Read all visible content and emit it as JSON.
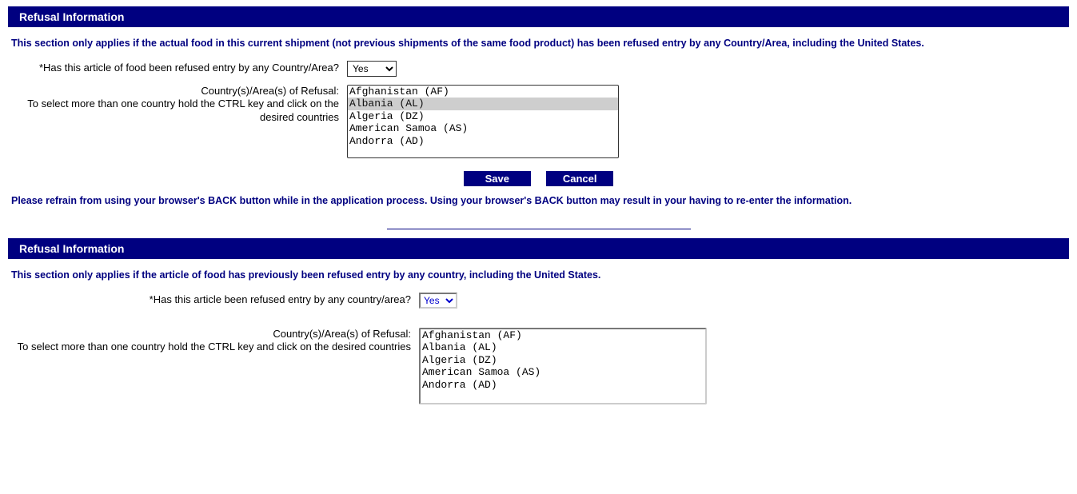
{
  "section1": {
    "header": "Refusal Information",
    "intro": "This section only applies if the actual food in this current shipment (not previous shipments of the same food product) has been refused entry by any Country/Area, including the United States.",
    "q1_label": "*Has this article of food been refused entry by any Country/Area?",
    "q1_value": "Yes",
    "q2_label_line1": "Country(s)/Area(s) of Refusal:",
    "q2_label_line2": "To select more than one country hold the CTRL key and click on the desired countries",
    "countries": [
      "Afghanistan (AF)",
      "Albania (AL)",
      "Algeria (DZ)",
      "American Samoa (AS)",
      "Andorra (AD)"
    ],
    "selected_country_index": 1,
    "save_label": "Save",
    "cancel_label": "Cancel",
    "note": "Please refrain from using your browser's BACK button while in the application process. Using your browser's BACK button may result in your having to re-enter the information."
  },
  "section2": {
    "header": "Refusal Information",
    "intro": "This section only applies if the article of food has previously been refused entry by any country, including the United States.",
    "q1_label": "*Has this article been refused entry by any country/area?",
    "q1_value": "Yes",
    "q2_label_line1": "Country(s)/Area(s) of Refusal:",
    "q2_label_line2": "To select more than one country hold the CTRL key and click on the desired countries",
    "countries": [
      "Afghanistan (AF)",
      "Albania (AL)",
      "Algeria (DZ)",
      "American Samoa (AS)",
      "Andorra (AD)"
    ]
  }
}
